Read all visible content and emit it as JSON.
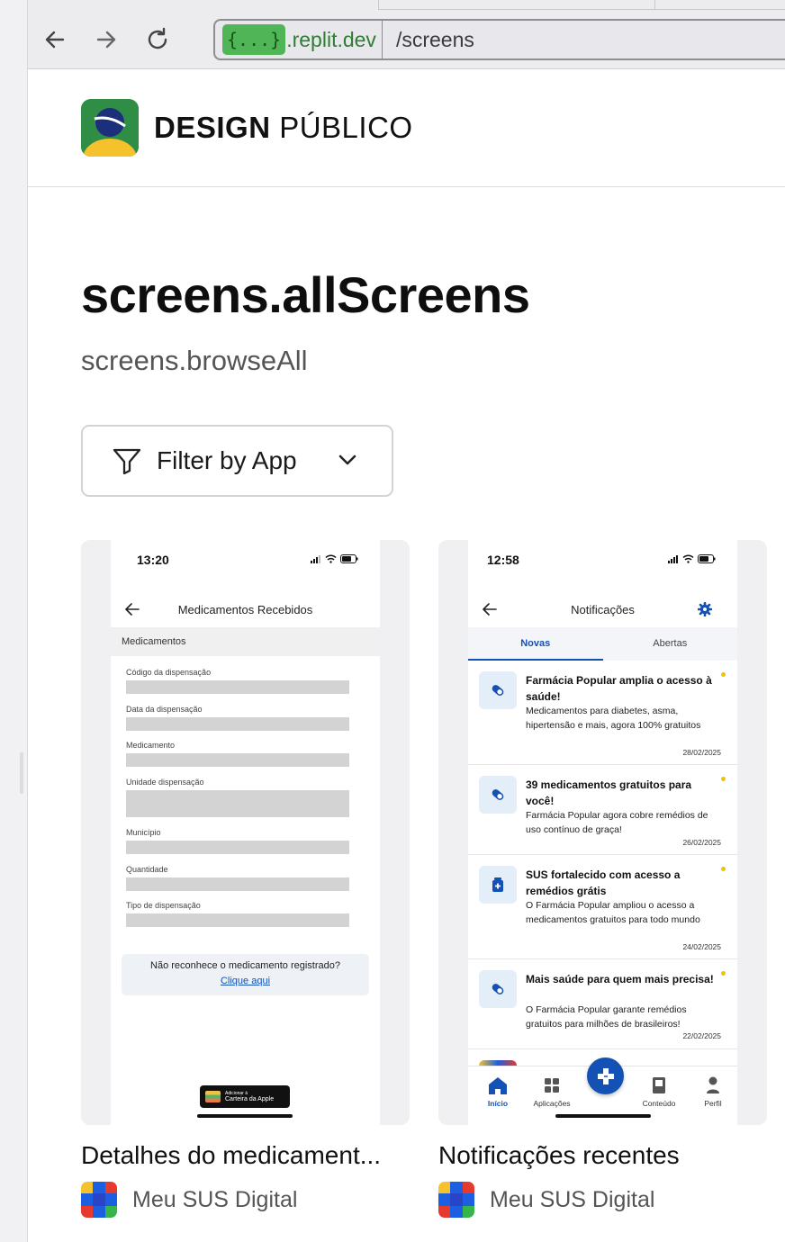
{
  "browser": {
    "address_domain": ".replit.dev",
    "address_chip": "{...}",
    "address_path": "/screens"
  },
  "header": {
    "brand_bold": "DESIGN",
    "brand_light": "PÚBLICO"
  },
  "main": {
    "title": "screens.allScreens",
    "subtitle": "screens.browseAll",
    "filter_label": "Filter by App"
  },
  "cards": [
    {
      "title": "Detalhes do medicament...",
      "app": "Meu SUS Digital",
      "phone": {
        "time": "13:20",
        "header": "Medicamentos Recebidos",
        "section": "Medicamentos",
        "fields": [
          "Código da dispensação",
          "Data da dispensação",
          "Medicamento",
          "Unidade dispensação",
          "Município",
          "Quantidade",
          "Tipo de dispensação"
        ],
        "help_text": "Não reconhece o medicamento registrado?",
        "help_link": "Clique aqui",
        "wallet_line1": "Adicionar à",
        "wallet_line2": "Carteira da Apple"
      }
    },
    {
      "title": "Notificações recentes",
      "app": "Meu SUS Digital",
      "phone": {
        "time": "12:58",
        "header": "Notificações",
        "tabs": [
          "Novas",
          "Abertas"
        ],
        "notifications": [
          {
            "title": "Farmácia Popular amplia o acesso à saúde!",
            "body": "Medicamentos para diabetes, asma, hipertensão e mais, agora 100% gratuitos",
            "date": "28/02/2025",
            "icon": "pill-icon"
          },
          {
            "title": "39 medicamentos gratuitos para você!",
            "body": "Farmácia Popular agora cobre remédios de uso contínuo de graça!",
            "date": "26/02/2025",
            "icon": "pill-icon"
          },
          {
            "title": "SUS fortalecido com acesso a remédios grátis",
            "body": "O Farmácia Popular ampliou o acesso a medicamentos gratuitos para todo mundo",
            "date": "24/02/2025",
            "icon": "medicine-bottle-icon"
          },
          {
            "title": "Mais saúde para quem mais precisa!",
            "body": "O Farmácia Popular garante remédios gratuitos para milhões de brasileiros!",
            "date": "22/02/2025",
            "icon": "pill-icon"
          }
        ],
        "nav": [
          "Início",
          "Aplicações",
          "Conteúdo",
          "Perfil"
        ]
      }
    }
  ],
  "colors": {
    "gov_blue": "#1351b4",
    "address_chip_green": "#4fb556",
    "notification_dot": "#f2c300"
  }
}
